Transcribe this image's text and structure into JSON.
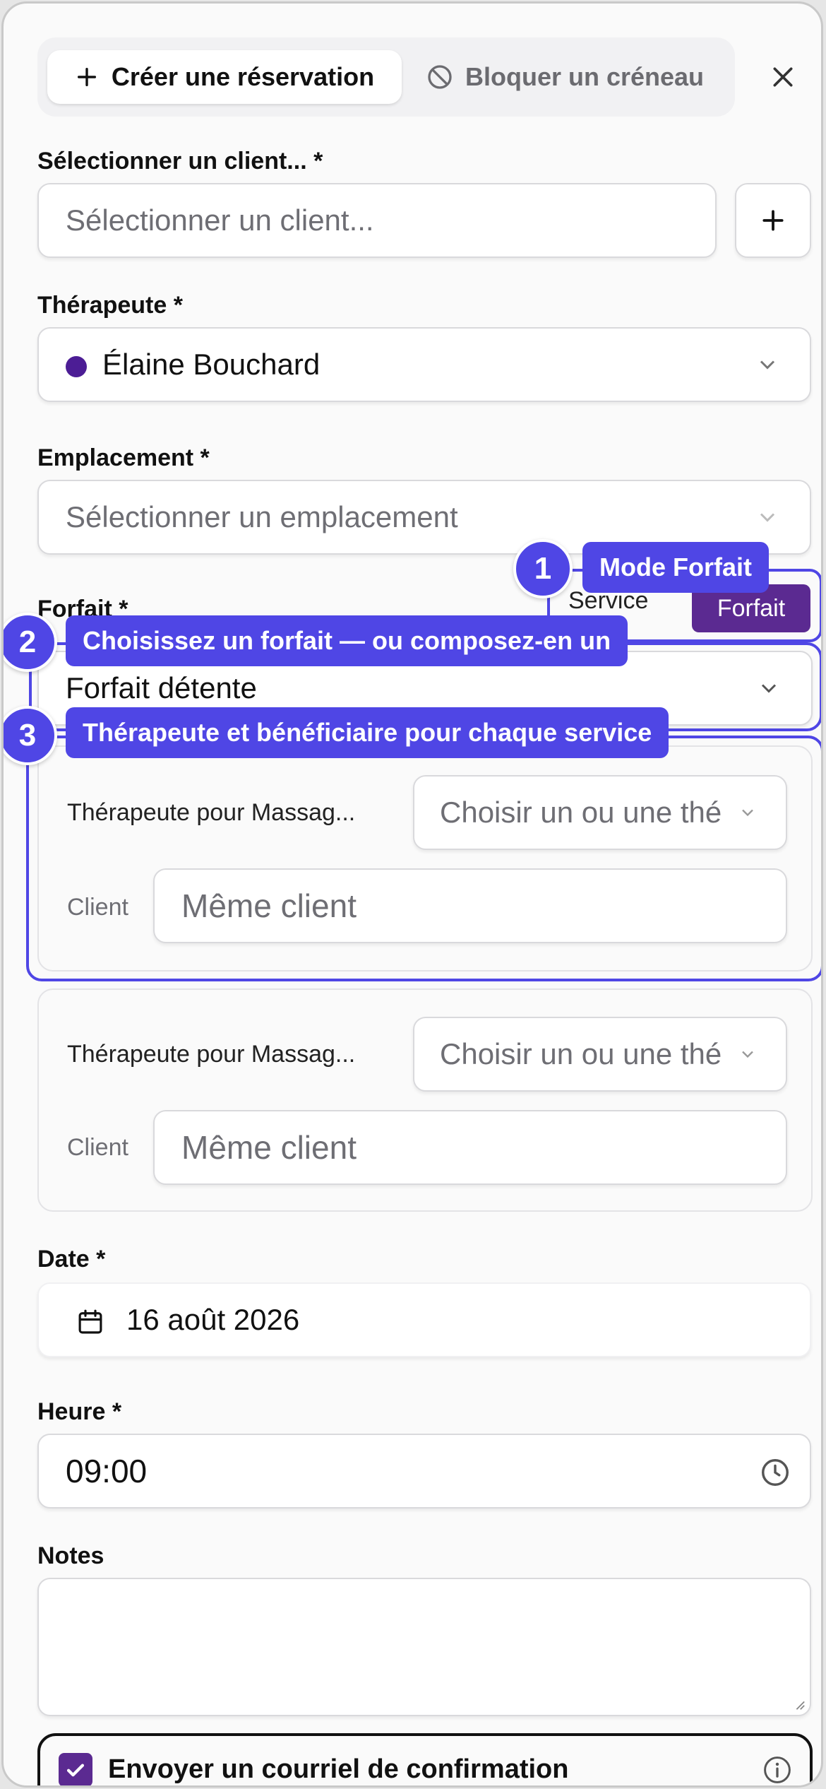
{
  "tabs": {
    "create_label": "Créer une réservation",
    "block_label": "Bloquer un créneau"
  },
  "client": {
    "label": "Sélectionner un client... *",
    "placeholder": "Sélectionner un client..."
  },
  "therapist": {
    "label": "Thérapeute *",
    "value": "Élaine Bouchard",
    "dot_color": "#4c1d95"
  },
  "location": {
    "label": "Emplacement *",
    "placeholder": "Sélectionner un emplacement"
  },
  "package": {
    "label": "Forfait *",
    "mode_service": "Service",
    "mode_package": "Forfait",
    "value": "Forfait détente"
  },
  "services": [
    {
      "therapist_label": "Thérapeute pour Massag...",
      "therapist_placeholder": "Choisir un ou une thé",
      "client_label": "Client",
      "client_placeholder": "Même client"
    },
    {
      "therapist_label": "Thérapeute pour Massag...",
      "therapist_placeholder": "Choisir un ou une thé",
      "client_label": "Client",
      "client_placeholder": "Même client"
    }
  ],
  "date": {
    "label": "Date *",
    "value": "16 août 2026"
  },
  "time": {
    "label": "Heure *",
    "value": "09:00"
  },
  "notes": {
    "label": "Notes",
    "value": ""
  },
  "confirmation": {
    "label": "Envoyer un courriel de confirmation",
    "checked": true
  },
  "callouts": [
    {
      "number": "1",
      "text": "Mode Forfait"
    },
    {
      "number": "2",
      "text": "Choisissez un forfait — ou composez-en un"
    },
    {
      "number": "3",
      "text": "Thérapeute et bénéficiaire pour chaque service"
    }
  ],
  "colors": {
    "accent": "#4f46e5",
    "brand": "#5b2a91"
  }
}
